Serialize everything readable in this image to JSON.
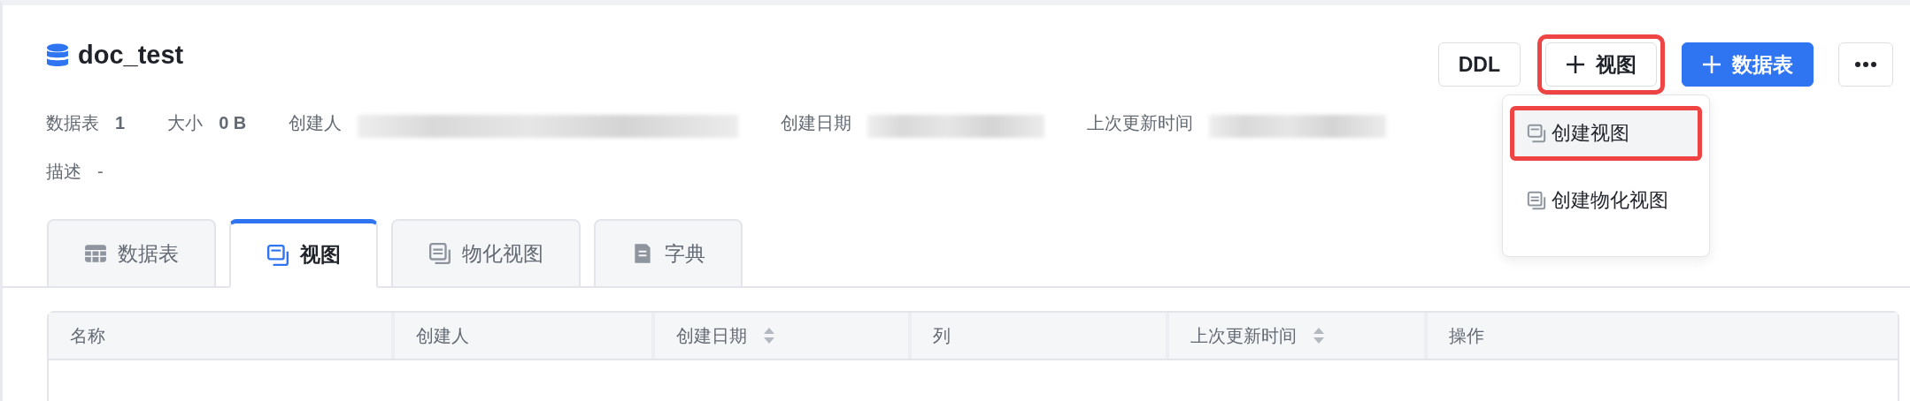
{
  "database": {
    "name": "doc_test"
  },
  "actions": [
    {
      "kind": "plain",
      "label": "DDL",
      "highlighted": false
    },
    {
      "kind": "add",
      "label": "视图",
      "highlighted": true
    },
    {
      "kind": "primary",
      "label": "数据表",
      "highlighted": false
    },
    {
      "kind": "more",
      "highlighted": false
    }
  ],
  "dropdown": {
    "items": [
      {
        "label": "创建视图",
        "selected": true,
        "highlighted": true
      },
      {
        "label": "创建物化视图",
        "selected": false,
        "highlighted": false
      }
    ]
  },
  "meta": [
    {
      "label": "数据表",
      "value": "1"
    },
    {
      "label": "大小",
      "value": "0 B"
    },
    {
      "label": "创建人",
      "redacted": true
    },
    {
      "label": "创建日期",
      "redacted": true
    },
    {
      "label": "上次更新时间",
      "redacted": true
    }
  ],
  "description": {
    "label": "描述",
    "value": "-"
  },
  "tabs": [
    {
      "label": "数据表",
      "selected": false
    },
    {
      "label": "视图",
      "selected": true
    },
    {
      "label": "物化视图",
      "selected": false
    },
    {
      "label": "字典",
      "selected": false
    }
  ],
  "table": {
    "columns": [
      {
        "label": "名称",
        "sortable": false
      },
      {
        "label": "创建人",
        "sortable": false
      },
      {
        "label": "创建日期",
        "sortable": true
      },
      {
        "label": "列",
        "sortable": false
      },
      {
        "label": "上次更新时间",
        "sortable": true
      },
      {
        "label": "操作",
        "sortable": false
      }
    ]
  }
}
